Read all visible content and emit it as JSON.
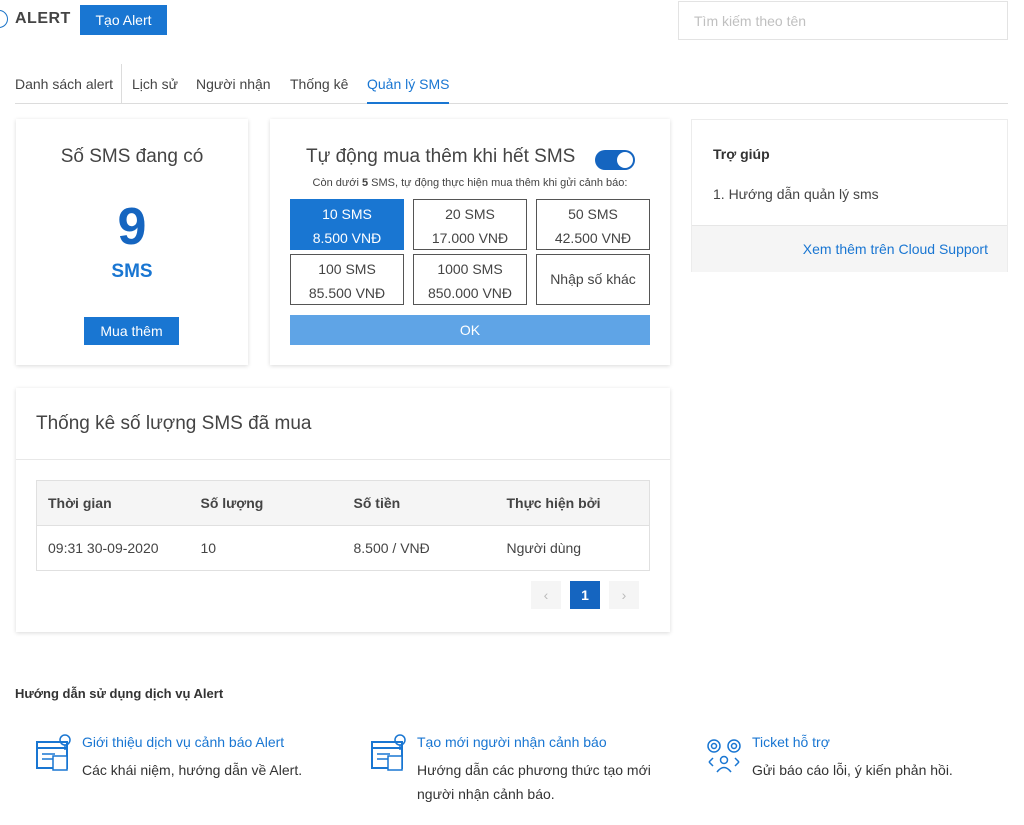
{
  "header": {
    "title": "ALERT",
    "create_button": "Tạo Alert",
    "search_placeholder": "Tìm kiếm theo tên"
  },
  "tabs": [
    {
      "label": "Danh sách alert",
      "active": false
    },
    {
      "label": "Lịch sử",
      "active": false
    },
    {
      "label": "Người nhận",
      "active": false
    },
    {
      "label": "Thống kê",
      "active": false
    },
    {
      "label": "Quản lý SMS",
      "active": true
    }
  ],
  "sms_balance": {
    "title": "Số SMS đang có",
    "count": "9",
    "unit": "SMS",
    "buy_button": "Mua thêm"
  },
  "auto_buy": {
    "title": "Tự động mua thêm khi hết SMS",
    "enabled": true,
    "desc_prefix": "Còn dưới ",
    "desc_threshold": "5",
    "desc_suffix": " SMS, tự động thực hiện mua thêm khi gửi cảnh báo:",
    "packages": [
      {
        "sms": "10 SMS",
        "price": "8.500 VNĐ",
        "selected": true
      },
      {
        "sms": "20 SMS",
        "price": "17.000 VNĐ",
        "selected": false
      },
      {
        "sms": "50 SMS",
        "price": "42.500 VNĐ",
        "selected": false
      },
      {
        "sms": "100 SMS",
        "price": "85.500 VNĐ",
        "selected": false
      },
      {
        "sms": "1000 SMS",
        "price": "850.000 VNĐ",
        "selected": false
      },
      {
        "sms": "Nhập số khác",
        "price": "",
        "selected": false
      }
    ],
    "ok_button": "OK"
  },
  "help": {
    "title": "Trợ giúp",
    "items": [
      "1. Hướng dẫn quản lý sms"
    ],
    "more_link": "Xem thêm trên Cloud Support"
  },
  "stats": {
    "title": "Thống kê số lượng SMS đã mua",
    "columns": [
      "Thời gian",
      "Số lượng",
      "Số tiền",
      "Thực hiện bởi"
    ],
    "rows": [
      [
        "09:31 30-09-2020",
        "10",
        "8.500 / VNĐ",
        "Người dùng"
      ]
    ],
    "pagination": {
      "prev": "‹",
      "current": "1",
      "next": "›"
    }
  },
  "guide": {
    "title": "Hướng dẫn sử dụng dịch vụ Alert",
    "items": [
      {
        "icon": "presentation-board-icon",
        "title": "Giới thiệu dịch vụ cảnh báo Alert",
        "desc": "Các khái niệm, hướng dẫn về Alert."
      },
      {
        "icon": "presentation-board-icon",
        "title": "Tạo mới người nhận cảnh báo",
        "desc": "Hướng dẫn các phương thức tạo mới người nhận cảnh báo."
      },
      {
        "icon": "support-ticket-icon",
        "title": "Ticket hỗ trợ",
        "desc": "Gửi báo cáo lỗi, ý kiến phản hồi."
      }
    ]
  },
  "colors": {
    "primary": "#1976d2",
    "primary_dark": "#1565c0",
    "ok_button": "#5fa4e6"
  }
}
